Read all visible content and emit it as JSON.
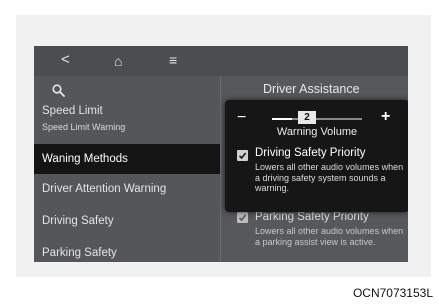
{
  "nav": {
    "back_glyph": "<",
    "home_glyph": "⌂",
    "menu_glyph": "≡"
  },
  "sidebar": {
    "items": [
      {
        "label": "Speed Limit",
        "sublabel": "Speed Limit Warning"
      },
      {
        "label": "Waning Methods",
        "selected": true
      },
      {
        "label": "Driver Attention Warning"
      },
      {
        "label": "Driving Safety"
      },
      {
        "label": "Parking Safety"
      }
    ]
  },
  "right": {
    "title": "Driver Assistance"
  },
  "popup": {
    "minus": "−",
    "plus": "+",
    "volume_value": "2",
    "volume_level_fraction": 0.22,
    "volume_title": "Warning Volume",
    "option_title": "Driving Safety Priority",
    "option_desc": "Lowers all other audio volumes when a driving safety system sounds a warning."
  },
  "option2": {
    "title": "Parking Safety Priority",
    "desc": "Lowers all other audio volumes when a parking assist view is active."
  },
  "caption": "OCN7073153L",
  "icons": [
    "search-icon",
    "back-icon",
    "home-icon",
    "menu-icon",
    "checkbox-checked-icon"
  ],
  "colors": {
    "screen_bg": "#555759",
    "selected_bg": "#141414",
    "popup_bg": "#161616"
  }
}
